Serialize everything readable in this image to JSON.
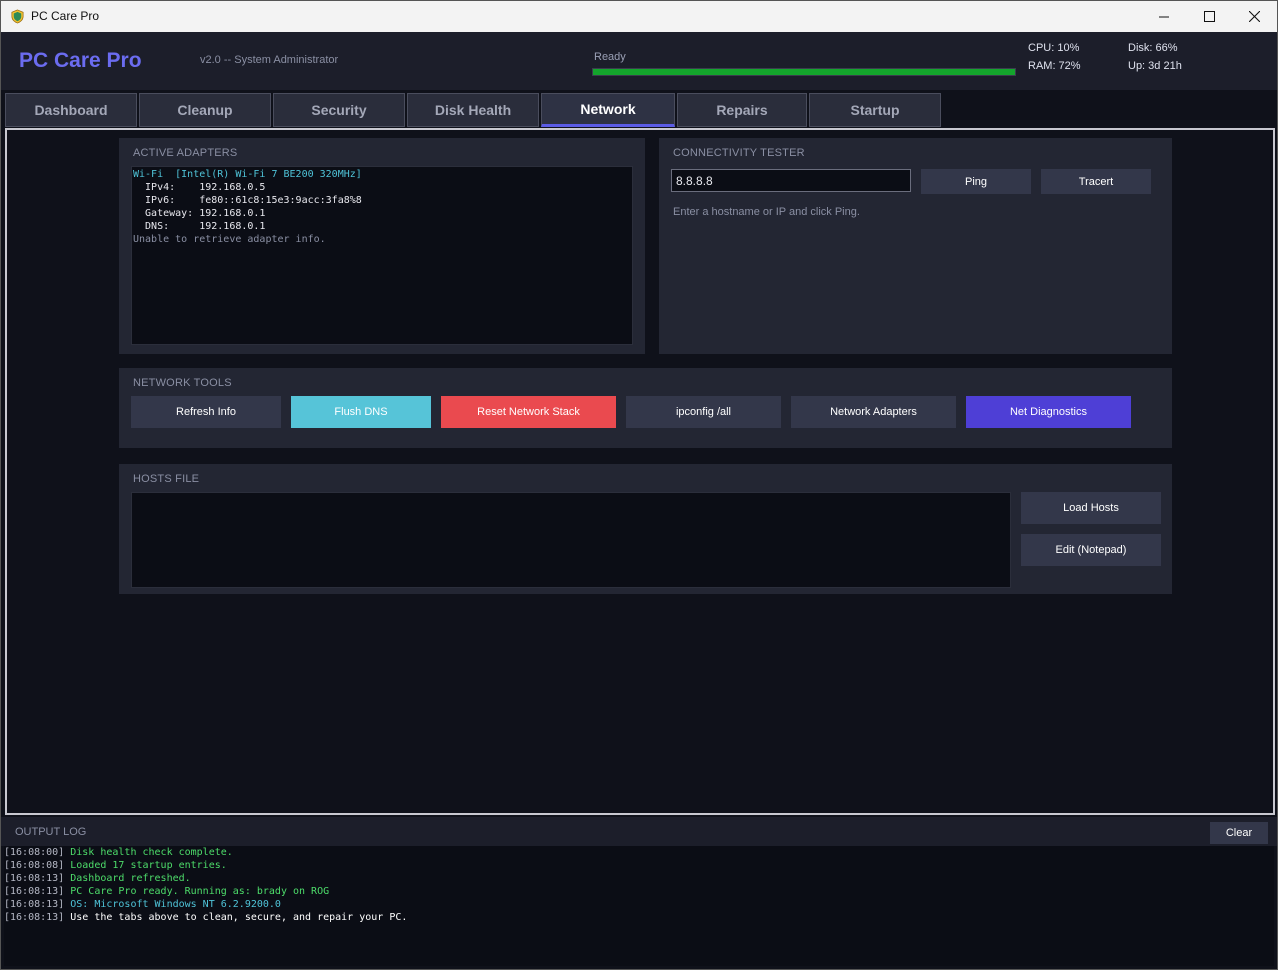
{
  "window": {
    "title": "PC Care Pro"
  },
  "header": {
    "app_name": "PC Care Pro",
    "subtitle": "v2.0  --  System Administrator",
    "status": "Ready",
    "progress": 1.0,
    "stats": {
      "cpu": "CPU: 10%",
      "ram": "RAM: 72%",
      "disk": "Disk: 66%",
      "uptime": "Up: 3d 21h"
    }
  },
  "tabs": [
    {
      "label": "Dashboard"
    },
    {
      "label": "Cleanup"
    },
    {
      "label": "Security"
    },
    {
      "label": "Disk Health"
    },
    {
      "label": "Network",
      "active": true
    },
    {
      "label": "Repairs"
    },
    {
      "label": "Startup"
    }
  ],
  "adapters": {
    "title": "ACTIVE ADAPTERS",
    "lines": [
      {
        "text": "Wi-Fi  [Intel(R) Wi-Fi 7 BE200 320MHz]",
        "style": "cyan"
      },
      {
        "text": "  IPv4:    192.168.0.5",
        "style": ""
      },
      {
        "text": "  IPv6:    fe80::61c8:15e3:9acc:3fa8%8",
        "style": ""
      },
      {
        "text": "  Gateway: 192.168.0.1",
        "style": ""
      },
      {
        "text": "  DNS:     192.168.0.1",
        "style": ""
      },
      {
        "text": "Unable to retrieve adapter info.",
        "style": "dim"
      }
    ]
  },
  "connectivity": {
    "title": "CONNECTIVITY TESTER",
    "host_value": "8.8.8.8",
    "ping_label": "Ping",
    "tracert_label": "Tracert",
    "hint": "Enter a hostname or IP and click Ping."
  },
  "tools": {
    "title": "NETWORK TOOLS",
    "refresh": "Refresh Info",
    "flush_dns": "Flush DNS",
    "reset_stack": "Reset Network Stack",
    "ipconfig": "ipconfig /all",
    "adapters": "Network Adapters",
    "diagnostics": "Net Diagnostics"
  },
  "hosts": {
    "title": "HOSTS FILE",
    "content": "",
    "load_label": "Load Hosts",
    "edit_label": "Edit (Notepad)"
  },
  "log": {
    "title": "OUTPUT LOG",
    "clear_label": "Clear",
    "entries": [
      {
        "time": "[16:08:00]",
        "msg": "Disk health check complete.",
        "color": "#4ddc6a"
      },
      {
        "time": "[16:08:08]",
        "msg": "Loaded 17 startup entries.",
        "color": "#4ddc6a"
      },
      {
        "time": "[16:08:13]",
        "msg": "Dashboard refreshed.",
        "color": "#4ddc6a"
      },
      {
        "time": "[16:08:13]",
        "msg": "PC Care Pro ready. Running as: brady on ROG",
        "color": "#4ddc6a"
      },
      {
        "time": "[16:08:13]",
        "msg": "OS: Microsoft Windows NT 6.2.9200.0",
        "color": "#4fc3d8"
      },
      {
        "time": "[16:08:13]",
        "msg": "Use the tabs above to clean, secure, and repair your PC.",
        "color": "#ffffff"
      }
    ]
  },
  "colors": {
    "accent": "#5b5ce6",
    "flush_dns": "#56c4d8",
    "reset_stack": "#ea4a4f",
    "diagnostics": "#4e3fd6",
    "progress": "#14a52c"
  }
}
